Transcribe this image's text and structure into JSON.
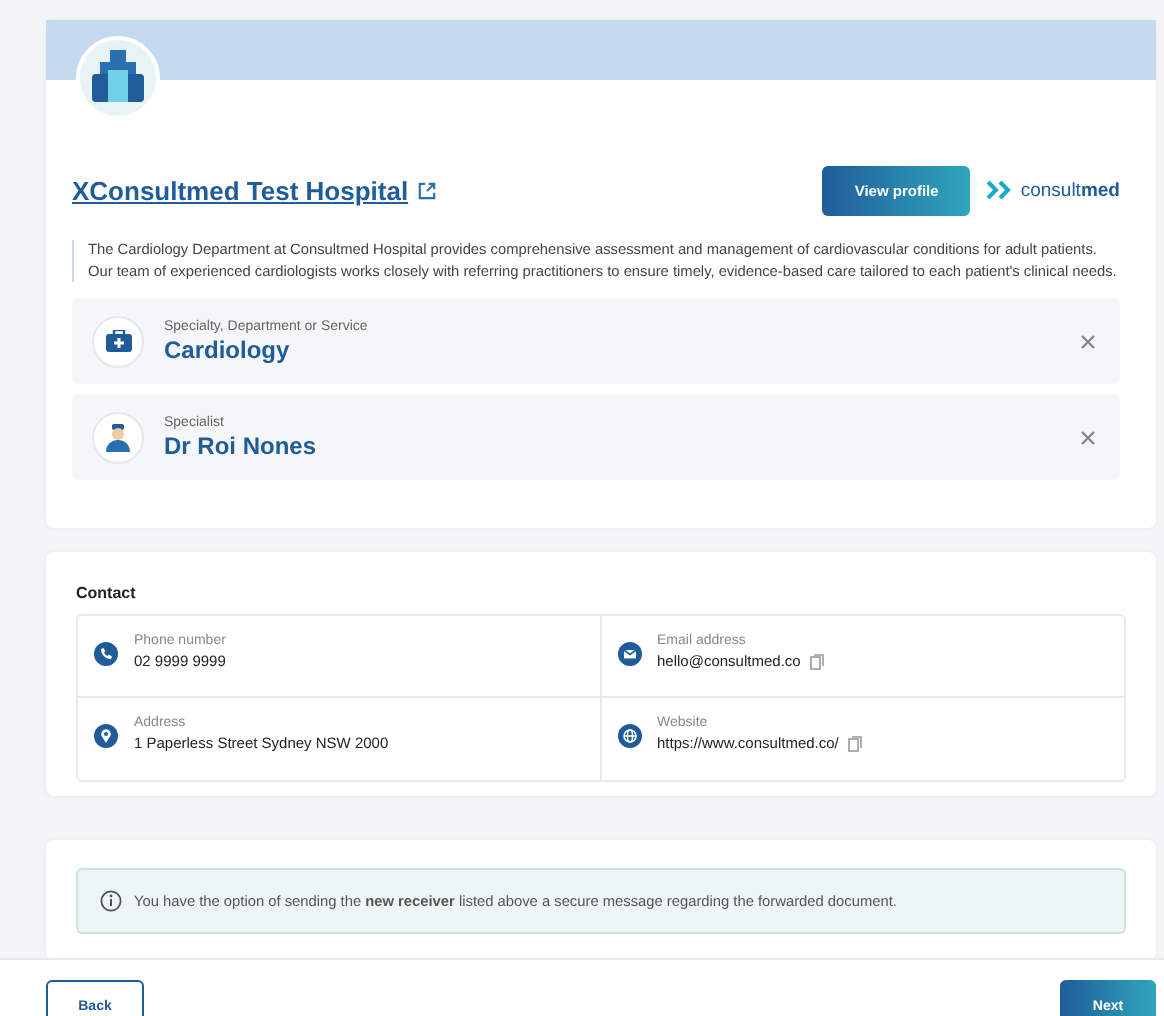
{
  "provider": {
    "name": "XConsultmed Test Hospital",
    "view_profile_button": "View profile",
    "brand": {
      "plain": "consult",
      "bold": "med"
    },
    "description": "The Cardiology Department at Consultmed Hospital provides comprehensive assessment and management of cardiovascular conditions for adult patients. Our team of experienced cardiologists works closely with referring practitioners to ensure timely, evidence-based care tailored to each patient's clinical needs."
  },
  "selections": [
    {
      "kind": "service",
      "label": "Specialty, Department or Service",
      "value": "Cardiology"
    },
    {
      "kind": "specialist",
      "label": "Specialist",
      "value": "Dr Roi Nones"
    }
  ],
  "contact": {
    "title": "Contact",
    "items": [
      {
        "kind": "phone",
        "label": "Phone number",
        "value": "02 9999 9999",
        "copyable": false
      },
      {
        "kind": "email",
        "label": "Email address",
        "value": "hello@consultmed.co",
        "copyable": true
      },
      {
        "kind": "address",
        "label": "Address",
        "value": "1 Paperless Street Sydney NSW 2000",
        "copyable": false
      },
      {
        "kind": "website",
        "label": "Website",
        "value": "https://www.consultmed.co/",
        "copyable": true
      }
    ]
  },
  "notice": "You have the option of sending the **new receiver** listed above a secure message regarding the forwarded document.",
  "footer": {
    "back": "Back",
    "next": "Next"
  }
}
